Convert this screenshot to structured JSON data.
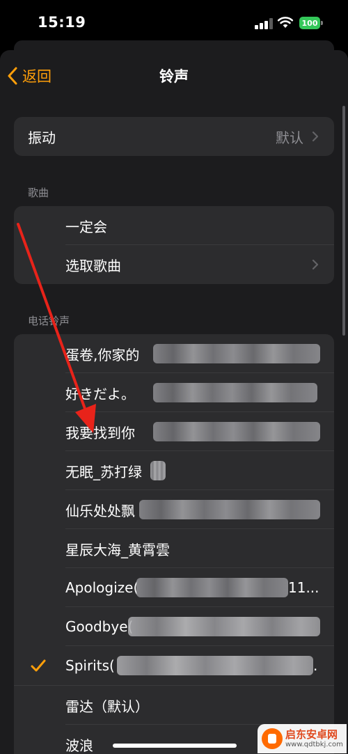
{
  "status_bar": {
    "time": "15:19",
    "battery": "100",
    "battery_color": "#34c759"
  },
  "nav": {
    "back_label": "返回",
    "title": "铃声",
    "accent": "#ff9f0a"
  },
  "vibration": {
    "label": "振动",
    "value": "默认"
  },
  "songs": {
    "header": "歌曲",
    "items": [
      {
        "label": "一定会"
      },
      {
        "label": "选取歌曲"
      }
    ]
  },
  "ringtones": {
    "header": "电话铃声",
    "items": [
      {
        "label": "蛋卷,你家的"
      },
      {
        "label": "好きだよ。"
      },
      {
        "label": "我要找到你"
      },
      {
        "label": "无眠_苏打绿"
      },
      {
        "label": "仙乐处处飘"
      },
      {
        "label": "星辰大海_黄霄雲"
      },
      {
        "label": "Apologize(",
        "suffix": "11..."
      },
      {
        "label": "Goodbye("
      },
      {
        "label": "Spirits(",
        "suffix": ".",
        "selected": true
      },
      {
        "label": "雷达（默认）"
      },
      {
        "label": "波浪"
      }
    ]
  },
  "watermark": {
    "name": "启东安卓网",
    "url": "www.qdtbkj.com"
  }
}
